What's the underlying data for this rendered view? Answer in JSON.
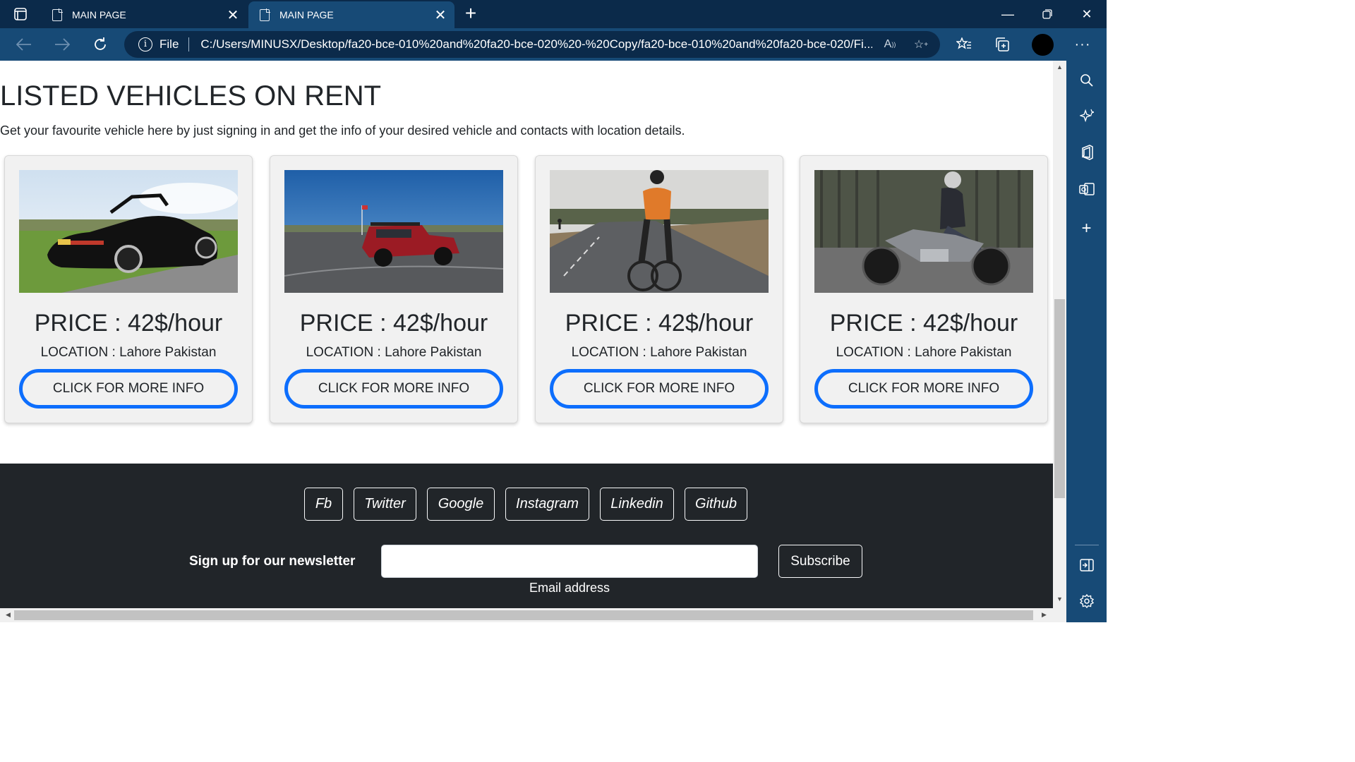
{
  "browser": {
    "tabs": [
      {
        "title": "MAIN PAGE",
        "active": false
      },
      {
        "title": "MAIN PAGE",
        "active": true
      }
    ],
    "address": {
      "scheme_label": "File",
      "url": "C:/Users/MINUSX/Desktop/fa20-bce-010%20and%20fa20-bce-020%20-%20Copy/fa20-bce-010%20and%20fa20-bce-020/Fi..."
    },
    "icons": {
      "tab_actions": "tab-actions-icon",
      "back": "back-arrow-icon",
      "forward": "forward-arrow-icon",
      "refresh": "refresh-icon",
      "read_aloud": "read-aloud-icon",
      "add_favorite": "add-favorite-icon",
      "favorites": "favorites-icon",
      "collections": "collections-icon",
      "more": "more-icon"
    },
    "sidebar_icons": [
      "search-icon",
      "copilot-icon",
      "office-icon",
      "outlook-icon",
      "add-icon",
      "hide-sidebar-icon",
      "settings-icon"
    ],
    "colors": {
      "frame_dark": "#0b2a4a",
      "frame": "#174a76"
    }
  },
  "page": {
    "heading": "LISTED VEHICLES ON RENT",
    "intro": "Get your favourite vehicle here by just signing in and get the info of your desired vehicle and contacts with location details.",
    "cards": [
      {
        "image": "black convertible car",
        "price": "PRICE : 42$/hour",
        "location": "LOCATION : Lahore Pakistan",
        "button": "CLICK FOR MORE INFO"
      },
      {
        "image": "red jeep",
        "price": "PRICE : 42$/hour",
        "location": "LOCATION : Lahore Pakistan",
        "button": "CLICK FOR MORE INFO"
      },
      {
        "image": "road cyclist",
        "price": "PRICE : 42$/hour",
        "location": "LOCATION : Lahore Pakistan",
        "button": "CLICK FOR MORE INFO"
      },
      {
        "image": "motorcycle rider",
        "price": "PRICE : 42$/hour",
        "location": "LOCATION : Lahore Pakistan",
        "button": "CLICK FOR MORE INFO"
      }
    ],
    "footer": {
      "social": [
        "Fb",
        "Twitter",
        "Google",
        "Instagram",
        "Linkedin",
        "Github"
      ],
      "newsletter_label": "Sign up for our newsletter",
      "email_value": "",
      "email_help": "Email address",
      "subscribe": "Subscribe"
    },
    "colors": {
      "button_border": "#0d6efd",
      "footer_bg": "#212529"
    }
  }
}
